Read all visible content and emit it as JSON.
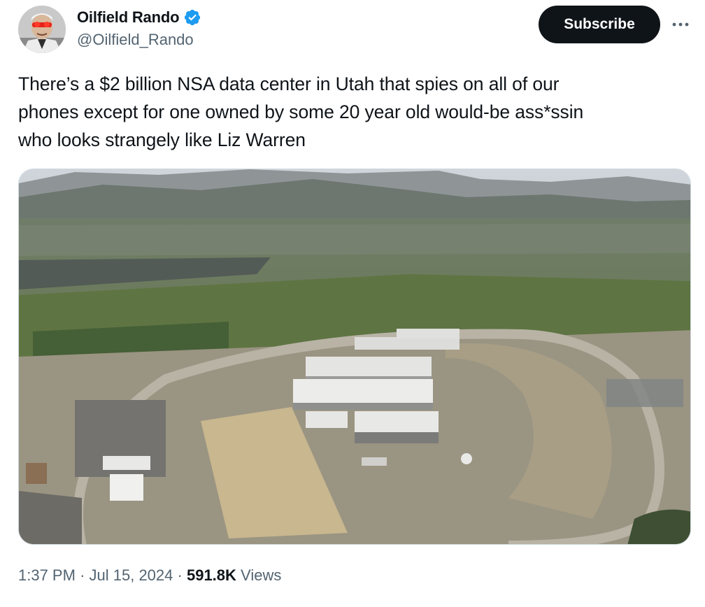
{
  "author": {
    "display_name": "Oilfield Rando",
    "handle": "@Oilfield_Rando",
    "verified": true,
    "avatar_icon": "profile-avatar",
    "verified_icon": "verified-badge-icon"
  },
  "actions": {
    "subscribe_label": "Subscribe",
    "more_icon": "more-options-icon"
  },
  "tweet": {
    "text_lines": [
      "There’s a $2 billion NSA data center in Utah that spies on all of our",
      "phones except for one owned by some 20 year old would-be ass*ssin",
      "who looks strangely like Liz Warren"
    ]
  },
  "meta": {
    "time": "1:37 PM",
    "separator": "·",
    "date": "Jul 15, 2024",
    "views_count": "591.8K",
    "views_label": "Views"
  },
  "colors": {
    "text_primary": "#0f1419",
    "text_secondary": "#536471",
    "verified_blue": "#1d9bf0",
    "button_bg": "#0f1419",
    "button_text": "#ffffff"
  }
}
